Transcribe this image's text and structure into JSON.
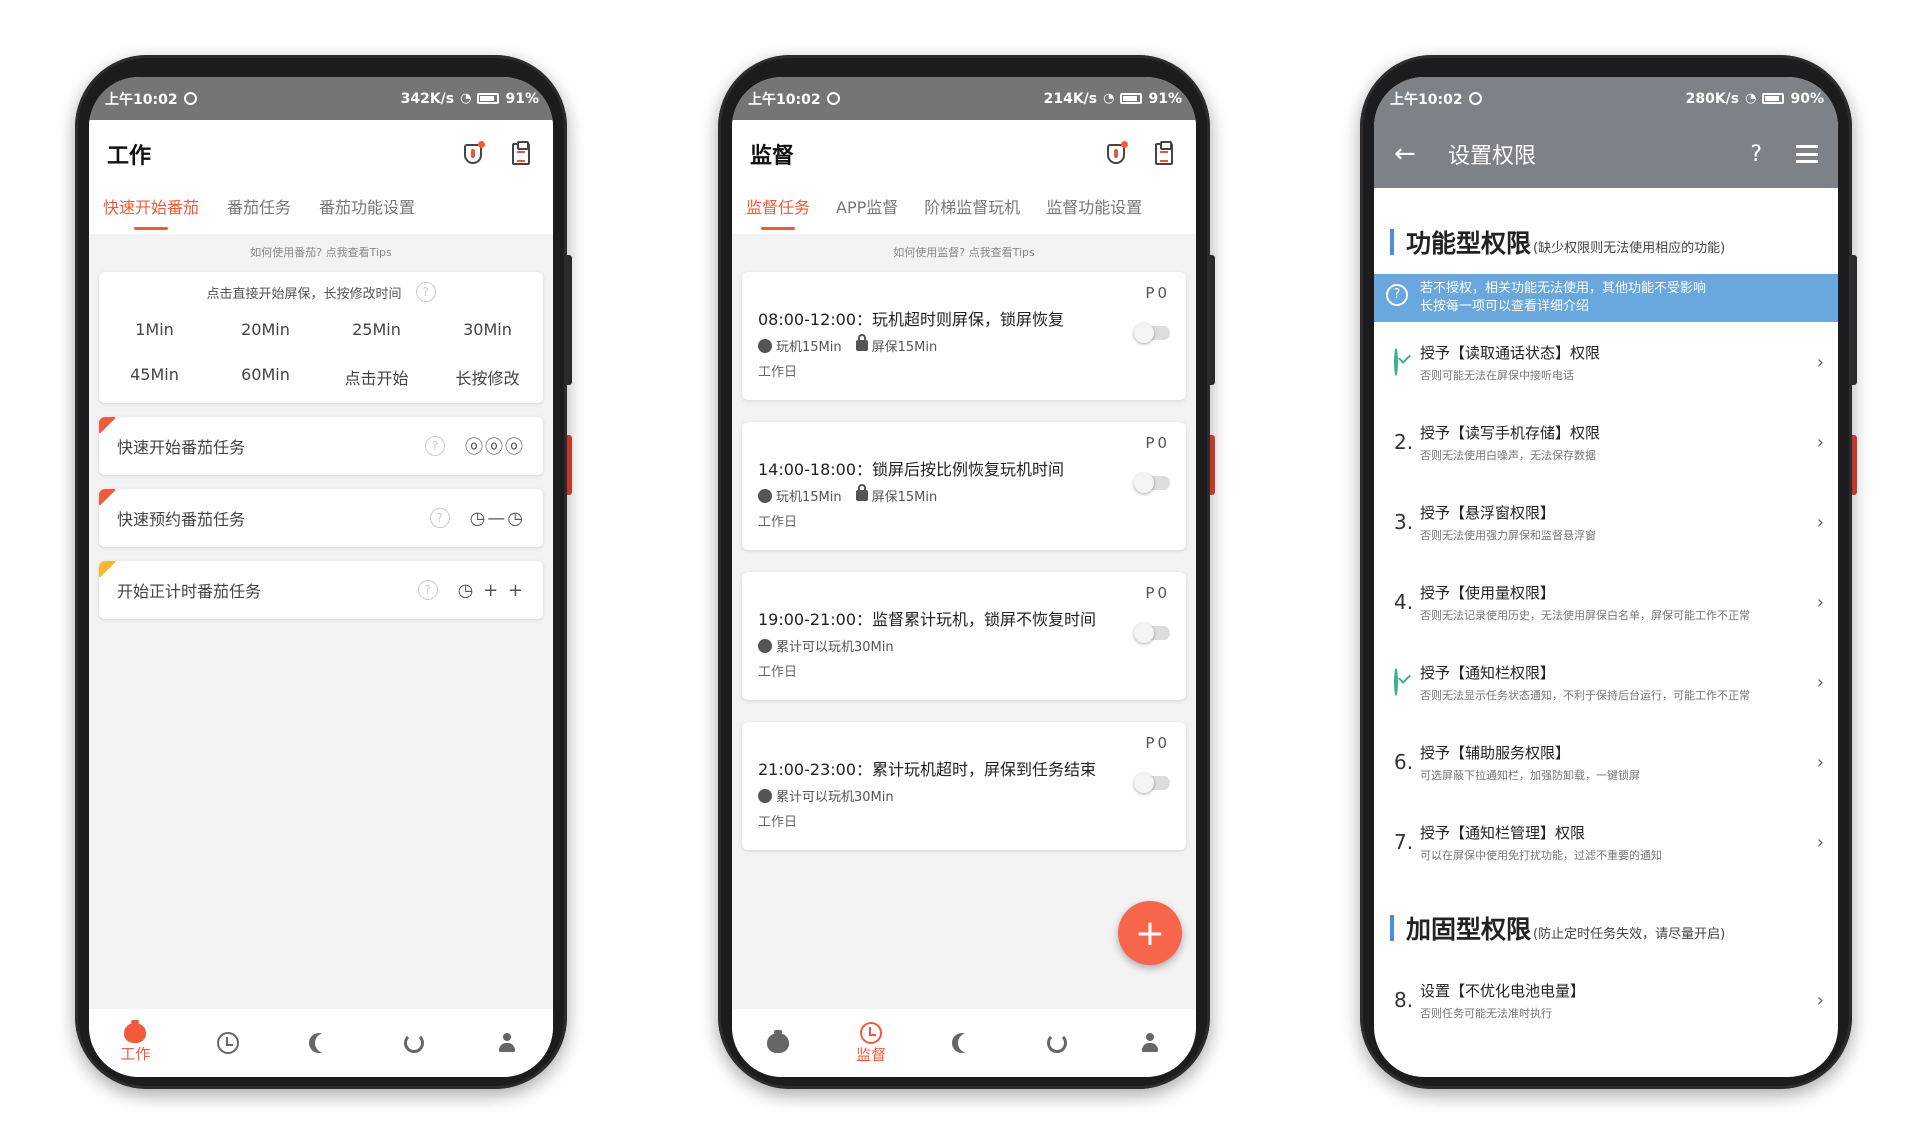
{
  "status": [
    {
      "time": "上午10:02",
      "speed": "342K/s",
      "battery": "91%"
    },
    {
      "time": "上午10:02",
      "speed": "214K/s",
      "battery": "91%"
    },
    {
      "time": "上午10:02",
      "speed": "280K/s",
      "battery": "90%"
    }
  ],
  "work": {
    "title": "工作",
    "tabs": [
      "快速开始番茄",
      "番茄任务",
      "番茄功能设置"
    ],
    "tips": "如何使用番茄? 点我查看Tips",
    "quick_hint": "点击直接开始屏保，长按修改时间",
    "quick_options": [
      "1Min",
      "20Min",
      "25Min",
      "30Min",
      "45Min",
      "60Min",
      "点击开始",
      "长按修改"
    ],
    "tasks": [
      {
        "label": "快速开始番茄任务",
        "deco": "ó ó ó"
      },
      {
        "label": "快速预约番茄任务",
        "deco": "◷—◷"
      },
      {
        "label": "开始正计时番茄任务",
        "deco": "◷ + +"
      }
    ],
    "nav_active_label": "工作"
  },
  "supervise": {
    "title": "监督",
    "tabs": [
      "监督任务",
      "APP监督",
      "阶梯监督玩机",
      "监督功能设置"
    ],
    "tips": "如何使用监督? 点我查看Tips",
    "cards": [
      {
        "prio": "P0",
        "title": "08:00-12:00：玩机超时则屏保，锁屏恢复",
        "meta1": "玩机15Min",
        "meta2": "屏保15Min",
        "day": "工作日"
      },
      {
        "prio": "P0",
        "title": "14:00-18:00：锁屏后按比例恢复玩机时间",
        "meta1": "玩机15Min",
        "meta2": "屏保15Min",
        "day": "工作日"
      },
      {
        "prio": "P0",
        "title": "19:00-21:00：监督累计玩机，锁屏不恢复时间",
        "meta1": "累计可以玩机30Min",
        "meta2": "",
        "day": "工作日"
      },
      {
        "prio": "P0",
        "title": "21:00-23:00：累计玩机超时，屏保到任务结束",
        "meta1": "累计可以玩机30Min",
        "meta2": "",
        "day": "工作日"
      }
    ],
    "fab": "+",
    "nav_active_label": "监督"
  },
  "permissions": {
    "title": "设置权限",
    "help": "?",
    "section1_title": "功能型权限",
    "section1_sub": "(缺少权限则无法使用相应的功能)",
    "banner_line1": "若不授权，相关功能无法使用，其他功能不受影响",
    "banner_line2": "长按每一项可以查看详细介绍",
    "items": [
      {
        "num": "",
        "checked": true,
        "title": "授予【读取通话状态】权限",
        "desc": "否则可能无法在屏保中接听电话"
      },
      {
        "num": "2.",
        "checked": false,
        "title": "授予【读写手机存储】权限",
        "desc": "否则无法使用白噪声，无法保存数据"
      },
      {
        "num": "3.",
        "checked": false,
        "title": "授予【悬浮窗权限】",
        "desc": "否则无法使用强力屏保和监督悬浮窗"
      },
      {
        "num": "4.",
        "checked": false,
        "title": "授予【使用量权限】",
        "desc": "否则无法记录使用历史，无法使用屏保白名单，屏保可能工作不正常"
      },
      {
        "num": "",
        "checked": true,
        "title": "授予【通知栏权限】",
        "desc": "否则无法显示任务状态通知，不利于保持后台运行，可能工作不正常"
      },
      {
        "num": "6.",
        "checked": false,
        "title": "授予【辅助服务权限】",
        "desc": "可选屏蔽下拉通知栏，加强防卸载，一键锁屏"
      },
      {
        "num": "7.",
        "checked": false,
        "title": "授予【通知栏管理】权限",
        "desc": "可以在屏保中使用免打扰功能，过滤不重要的通知"
      }
    ],
    "section2_title": "加固型权限",
    "section2_sub": "(防止定时任务失效，请尽量开启)",
    "items2": [
      {
        "num": "8.",
        "title": "设置【不优化电池电量】",
        "desc": "否则任务可能无法准时执行"
      }
    ]
  },
  "colors": {
    "accent": "#f15a3c",
    "banner": "#69a8df",
    "permbar": "#7d8188",
    "check": "#3bb38a"
  }
}
